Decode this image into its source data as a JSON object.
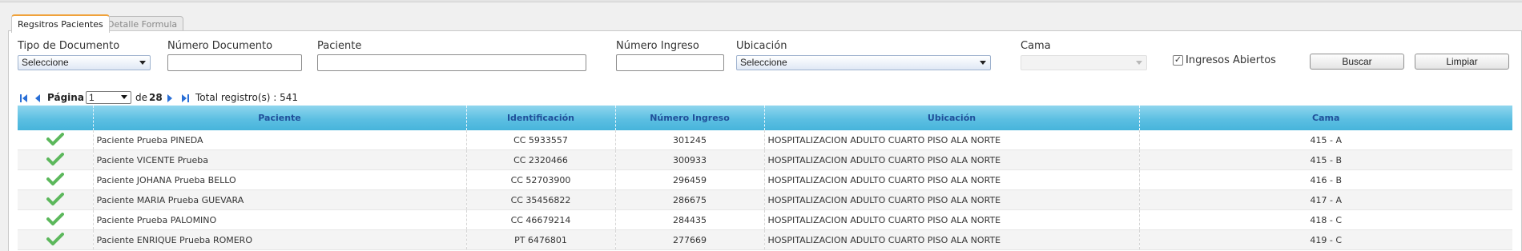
{
  "tabs": [
    {
      "label": "Regsitros Pacientes"
    },
    {
      "label": "Detalle Formula"
    }
  ],
  "filters": {
    "tipo_documento": {
      "label": "Tipo de Documento",
      "value": "Seleccione"
    },
    "numero_documento": {
      "label": "Número Documento",
      "value": ""
    },
    "paciente": {
      "label": "Paciente",
      "value": ""
    },
    "numero_ingreso": {
      "label": "Número Ingreso",
      "value": ""
    },
    "ubicacion": {
      "label": "Ubicación",
      "value": "Seleccione"
    },
    "cama": {
      "label": "Cama",
      "value": ""
    },
    "ingresos_abiertos": {
      "label": "Ingresos Abiertos",
      "checked": true
    },
    "buscar_label": "Buscar",
    "limpiar_label": "Limpiar"
  },
  "pager": {
    "pagina_label": "Página",
    "current_page": "1",
    "de_label": "de",
    "total_pages": "28",
    "total_label": "Total registro(s) : 541"
  },
  "table": {
    "columns": [
      "",
      "Paciente",
      "Identificación",
      "Número Ingreso",
      "Ubicación",
      "Cama"
    ],
    "rows": [
      {
        "paciente": "Paciente Prueba PINEDA",
        "identificacion": "CC 5933557",
        "ingreso": "301245",
        "ubicacion": "HOSPITALIZACION ADULTO CUARTO PISO ALA NORTE",
        "cama": "415 - A"
      },
      {
        "paciente": "Paciente VICENTE Prueba",
        "identificacion": "CC 2320466",
        "ingreso": "300933",
        "ubicacion": "HOSPITALIZACION ADULTO CUARTO PISO ALA NORTE",
        "cama": "415 - B"
      },
      {
        "paciente": "Paciente JOHANA Prueba BELLO",
        "identificacion": "CC 52703900",
        "ingreso": "296459",
        "ubicacion": "HOSPITALIZACION ADULTO CUARTO PISO ALA NORTE",
        "cama": "416 - B"
      },
      {
        "paciente": "Paciente MARIA Prueba GUEVARA",
        "identificacion": "CC 35456822",
        "ingreso": "286675",
        "ubicacion": "HOSPITALIZACION ADULTO CUARTO PISO ALA NORTE",
        "cama": "417 - A"
      },
      {
        "paciente": "Paciente Prueba PALOMINO",
        "identificacion": "CC 46679214",
        "ingreso": "284435",
        "ubicacion": "HOSPITALIZACION ADULTO CUARTO PISO ALA NORTE",
        "cama": "418 - C"
      },
      {
        "paciente": "Paciente ENRIQUE Prueba ROMERO",
        "identificacion": "PT 6476801",
        "ingreso": "277669",
        "ubicacion": "HOSPITALIZACION ADULTO CUARTO PISO ALA NORTE",
        "cama": "419 - C"
      }
    ]
  },
  "icons": {
    "row_status": "check-icon",
    "pager": [
      "first-page-icon",
      "prev-page-icon",
      "next-page-icon",
      "last-page-icon"
    ]
  },
  "colors": {
    "header_gradient_top": "#8fd6ee",
    "header_gradient_bottom": "#47b4db",
    "header_text": "#1f4f9a",
    "check_green": "#5cb85c",
    "pager_icon": "#2a6fd6",
    "active_tab_accent": "#f0a23a"
  }
}
